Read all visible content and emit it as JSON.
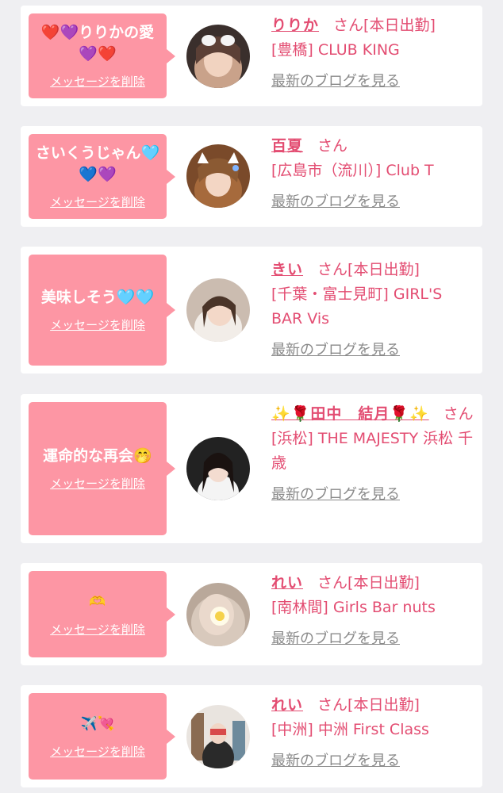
{
  "delete_label": "メッセージを削除",
  "blog_label": "最新のブログを見る",
  "entries": [
    {
      "message": "❤️💜りりかの愛💜❤️",
      "name": "りりか",
      "san": "さん",
      "status": "[本日出勤]",
      "shop": "[豊橋] CLUB KING"
    },
    {
      "message": "さいくうじゃん🩵💙💜",
      "name": "百夏",
      "san": "さん",
      "status": "",
      "shop": "[広島市（流川）] Club T"
    },
    {
      "message": "美味しそう🩵🩵",
      "name": "きい",
      "san": "さん",
      "status": "[本日出勤]",
      "shop": "[千葉・富士見町] GIRL'S BAR Vis"
    },
    {
      "message": "運命的な再会🤭",
      "name": "✨🌹田中　結月🌹✨",
      "san": "さん",
      "status": "",
      "shop": "[浜松] THE MAJESTY 浜松 千歳"
    },
    {
      "message": "🫶",
      "name": "れい",
      "san": "さん",
      "status": "[本日出勤]",
      "shop": "[南林間] Girls Bar nuts"
    },
    {
      "message": "✈️💘",
      "name": "れい",
      "san": "さん",
      "status": "[本日出勤]",
      "shop": "[中洲] 中洲 First Class"
    }
  ]
}
